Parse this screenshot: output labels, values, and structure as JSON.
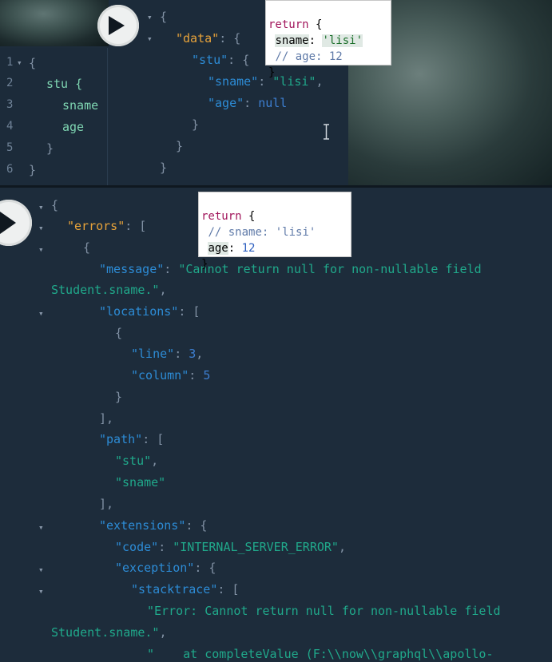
{
  "query_editor": {
    "gutter": [
      "1",
      "2",
      "3",
      "4",
      "5",
      "6"
    ],
    "lines": [
      "{",
      "stu {",
      "sname",
      "age",
      "}",
      "}"
    ]
  },
  "top_result": {
    "lines": [
      "{",
      "\"data\"",
      ": {",
      "\"stu\"",
      ": {",
      "\"sname\"",
      ": ",
      "\"lisi\"",
      ",",
      "\"age\"",
      ": ",
      "null",
      "}",
      "}",
      "}"
    ]
  },
  "bubble_top": {
    "line1_kw": "return",
    "line1_rest": " {",
    "line2_key": "sname",
    "line2_sep": ": ",
    "line2_val": "'lisi'",
    "line3": "// age: 12",
    "line4": "}"
  },
  "bubble_bottom": {
    "line1_kw": "return",
    "line1_rest": " {",
    "line2": "// sname: 'lisi'",
    "line3_key": "age",
    "line3_sep": ": ",
    "line3_val": "12",
    "line4": "}"
  },
  "error_result": {
    "errors_key": "\"errors\"",
    "message_key": "\"message\"",
    "message_val_1": "\"Cannot return null for non-nullable field",
    "message_val_2": "Student.sname.\"",
    "locations_key": "\"locations\"",
    "line_key": "\"line\"",
    "line_val": "3",
    "column_key": "\"column\"",
    "column_val": "5",
    "path_key": "\"path\"",
    "path_1": "\"stu\"",
    "path_2": "\"sname\"",
    "extensions_key": "\"extensions\"",
    "code_key": "\"code\"",
    "code_val": "\"INTERNAL_SERVER_ERROR\"",
    "exception_key": "\"exception\"",
    "stacktrace_key": "\"stacktrace\"",
    "stack_1a": "\"Error: Cannot return null for non-nullable field",
    "stack_1b": "Student.sname.\"",
    "stack_2": "\"    at completeValue (F:\\\\now\\\\graphql\\\\apollo-"
  },
  "colors": {
    "background": "#1d2c3b",
    "key": "#2d8cd6",
    "string": "#20a98b",
    "number": "#3d7fd1",
    "orange_key": "#e8a33a"
  }
}
